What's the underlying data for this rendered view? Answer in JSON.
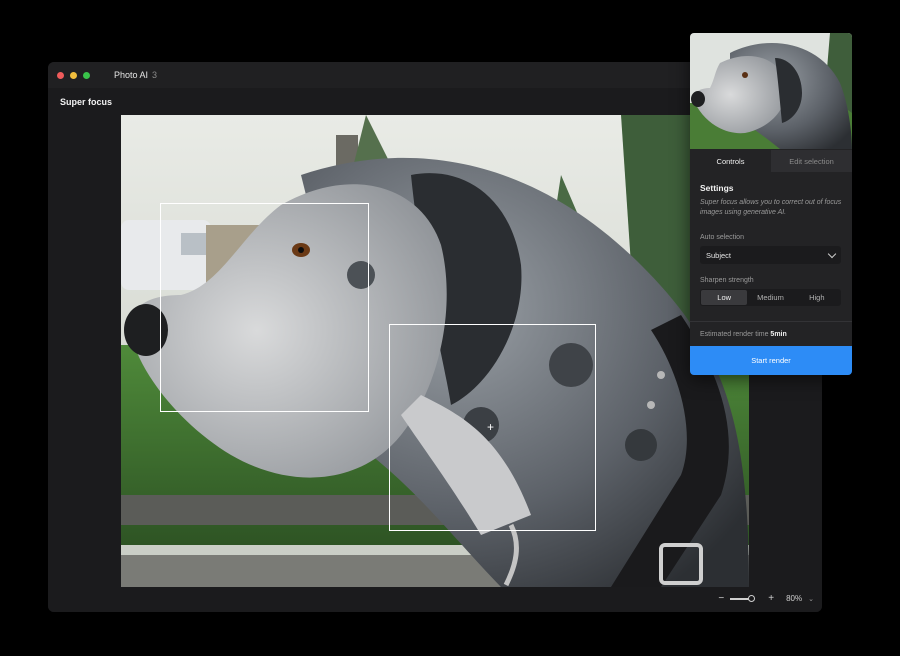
{
  "window": {
    "title": "Photo AI",
    "version": "3",
    "section_title": "Super focus"
  },
  "canvas": {
    "crosshair_glyph": "+"
  },
  "zoom": {
    "minus": "−",
    "plus": "+",
    "level": "80%",
    "chevron": "⌄"
  },
  "panel": {
    "tabs": [
      {
        "label": "Controls",
        "active": true
      },
      {
        "label": "Edit selection",
        "active": false
      }
    ],
    "settings_title": "Settings",
    "description": "Super focus allows you to correct out of focus images using generative AI.",
    "auto_selection_label": "Auto selection",
    "auto_selection_value": "Subject",
    "sharpen_label": "Sharpen strength",
    "sharpen_options": [
      "Low",
      "Medium",
      "High"
    ],
    "sharpen_selected": "Low",
    "render_time_label": "Estimated render time",
    "render_time_value": "5min",
    "start_button": "Start render"
  },
  "colors": {
    "accent": "#2d8cf6",
    "window_bg": "#1b1b1d",
    "panel_bg": "#232325"
  }
}
